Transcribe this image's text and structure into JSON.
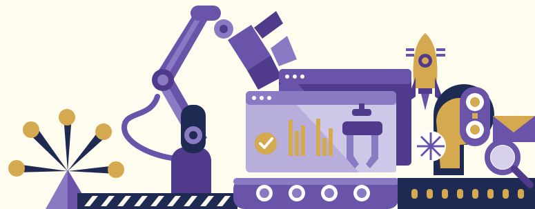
{
  "palette": {
    "background": "#fdfcef",
    "purple_dark": "#4f3a8c",
    "purple": "#6a54aa",
    "purple_mid": "#8a7ac3",
    "purple_light": "#b7aedb",
    "navy": "#1f2a52",
    "gold": "#d4a94f",
    "white": "#ffffff"
  },
  "icons": [
    "pinwheel-icon",
    "robot-arm-icon",
    "browser-window-icon",
    "checkmark-icon",
    "bar-chart-icon",
    "claw-gripper-icon",
    "conveyor-belt-icon",
    "rocket-icon",
    "location-pin-icon",
    "traffic-light-icon",
    "envelope-icon",
    "magnifier-icon"
  ]
}
